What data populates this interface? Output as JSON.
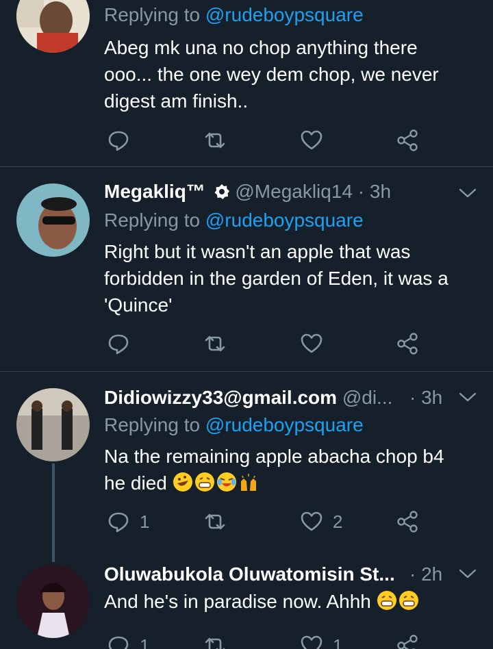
{
  "tweets": [
    {
      "replying_prefix": "Replying to",
      "replying_to": "@rudeboypsquare",
      "text_lines": [
        "Abeg mk una no chop anything there",
        "ooo... the one wey dem chop, we never",
        "digest am finish.."
      ],
      "reply_count": "",
      "like_count": ""
    },
    {
      "name": "Megakliq™",
      "handle": "@Megakliq14",
      "time": "· 3h",
      "replying_prefix": "Replying to",
      "replying_to": "@rudeboypsquare",
      "text_lines": [
        "Right but it wasn't an apple that was",
        "forbidden in the garden of Eden, it was a",
        "'Quince'"
      ],
      "reply_count": "",
      "like_count": ""
    },
    {
      "name": "Didiowizzy33@gmail.com",
      "handle": "@di...",
      "time": "· 3h",
      "replying_prefix": "Replying to",
      "replying_to": "@rudeboypsquare",
      "text_lines": [
        "Na the remaining apple abacha chop b4",
        "he died"
      ],
      "emojis": [
        "rolling-laughing-emoji",
        "grinning-emoji",
        "crying-laughing-emoji",
        "raised-hands-emoji"
      ],
      "reply_count": "1",
      "like_count": "2"
    },
    {
      "name": "Oluwabukola Oluwatomisin St...",
      "time": "· 2h",
      "text_lines": [
        "And he's in paradise now. Ahhh"
      ],
      "emojis": [
        "grinning-emoji",
        "grinning-emoji"
      ],
      "reply_count": "1",
      "like_count": "1"
    }
  ],
  "icons": {
    "reply": "reply-icon",
    "retweet": "retweet-icon",
    "like": "heart-icon",
    "share": "share-icon",
    "more": "chevron-down-icon",
    "verified": "badge-icon"
  },
  "colors": {
    "background": "#15202b",
    "accent": "#1da1f2",
    "secondary_text": "#8899a6",
    "divider": "#38444d"
  }
}
